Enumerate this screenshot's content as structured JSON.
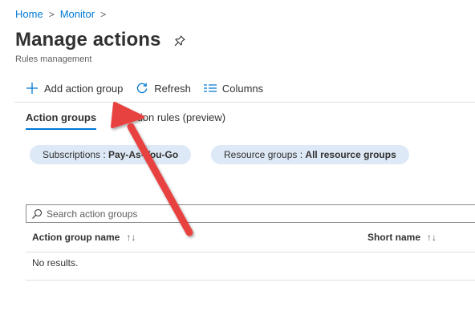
{
  "breadcrumb": {
    "home": "Home",
    "monitor": "Monitor",
    "separator": ">"
  },
  "page": {
    "title": "Manage actions",
    "subtitle": "Rules management"
  },
  "toolbar": {
    "add_label": "Add action group",
    "refresh_label": "Refresh",
    "columns_label": "Columns"
  },
  "tabs": [
    {
      "label": "Action groups",
      "active": true
    },
    {
      "label": "Action rules (preview)",
      "active": false
    }
  ],
  "filters": {
    "subscriptions": {
      "label": "Subscriptions :",
      "value": "Pay-As-You-Go"
    },
    "resource_groups": {
      "label": "Resource groups :",
      "value": "All resource groups"
    }
  },
  "search": {
    "placeholder": "Search action groups"
  },
  "table": {
    "columns": [
      {
        "label": "Action group name",
        "sort_icon": "↑↓"
      },
      {
        "label": "Short name",
        "sort_icon": "↑↓"
      }
    ],
    "empty_text": "No results."
  },
  "colors": {
    "accent": "#0078d4",
    "pill_bg": "#dde9f6",
    "annotation_arrow": "#e8423f"
  }
}
